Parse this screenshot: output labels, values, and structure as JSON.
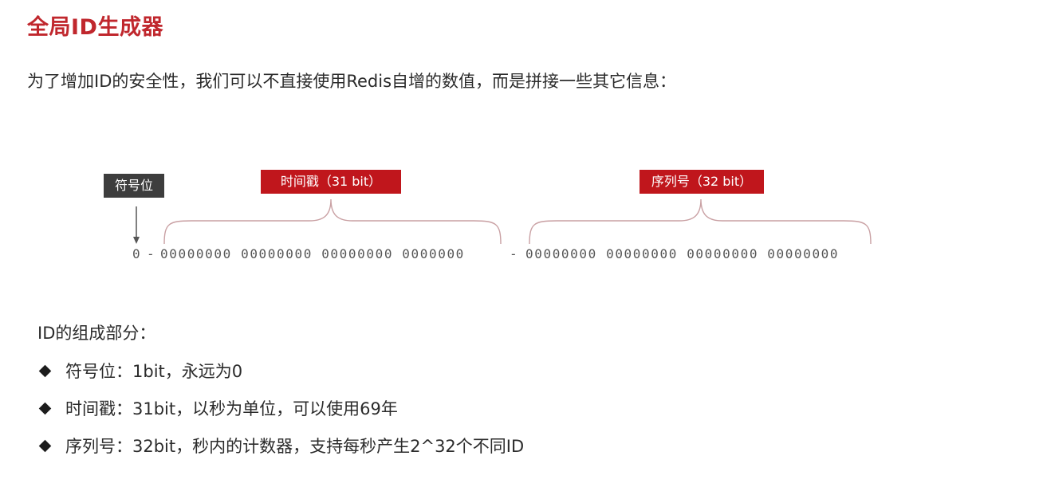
{
  "title": "全局ID生成器",
  "intro": "为了增加ID的安全性，我们可以不直接使用Redis自增的数值，而是拼接一些其它信息：",
  "diagram": {
    "tags": {
      "sign": "符号位",
      "timestamp": "时间戳（31 bit）",
      "sequence": "序列号（32 bit）"
    },
    "bits": {
      "sign": "0",
      "dash1": "-",
      "timestamp": "00000000 00000000 00000000 0000000",
      "dash2": "-",
      "sequence": "00000000 00000000 00000000 00000000"
    },
    "colors": {
      "tag_red": "#c0161c",
      "tag_dark": "#3d3d3d",
      "brace": "#c9a0a3",
      "title": "#c0272d"
    }
  },
  "parts": {
    "heading": "ID的组成部分：",
    "items": [
      "符号位：1bit，永远为0",
      "时间戳：31bit，以秒为单位，可以使用69年",
      "序列号：32bit，秒内的计数器，支持每秒产生2^32个不同ID"
    ]
  }
}
